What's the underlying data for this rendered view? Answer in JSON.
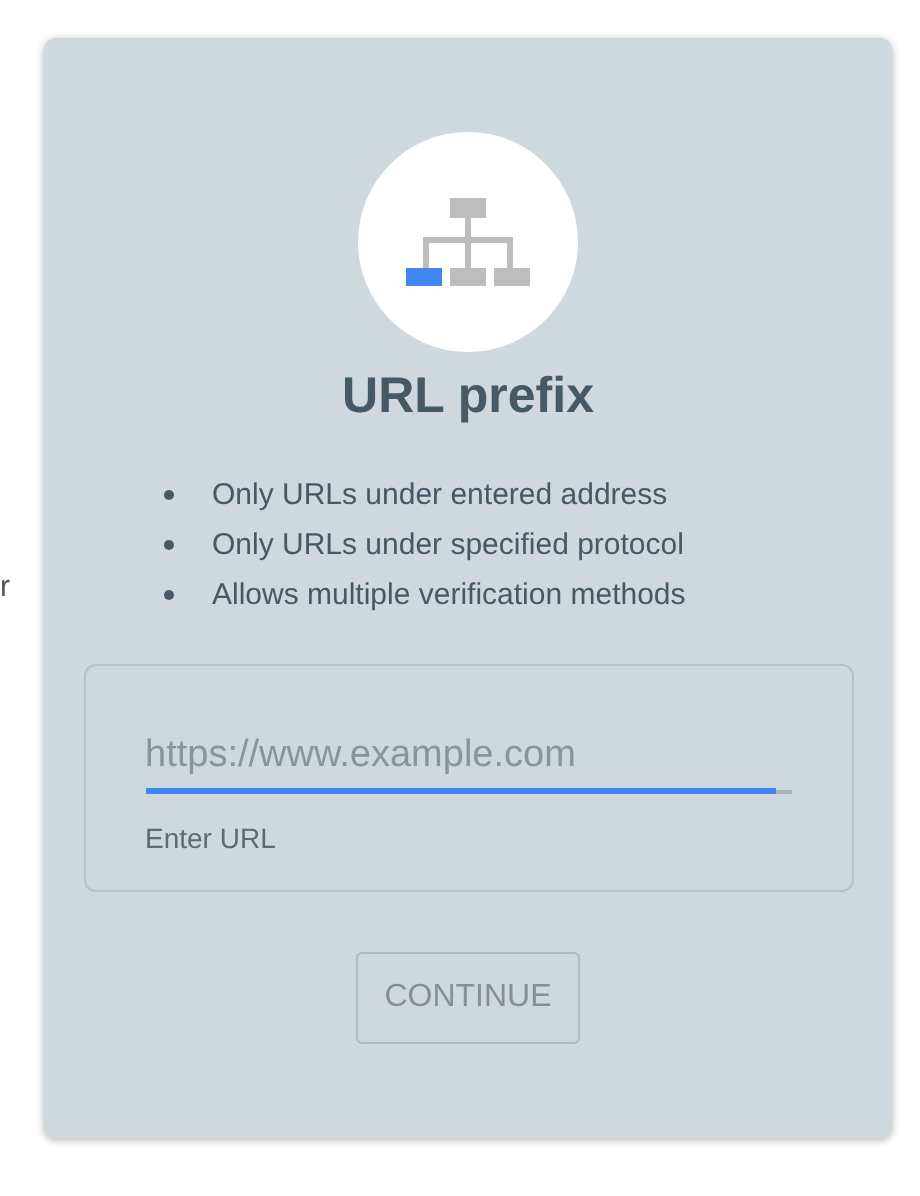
{
  "background_text": "r",
  "card": {
    "title": "URL prefix",
    "bullets": [
      "Only URLs under entered address",
      "Only URLs under specified protocol",
      "Allows multiple verification methods"
    ],
    "url_field": {
      "placeholder": "https://www.example.com",
      "focused": true,
      "helper": "Enter URL"
    },
    "continue_button": {
      "label": "CONTINUE",
      "disabled": true
    }
  }
}
